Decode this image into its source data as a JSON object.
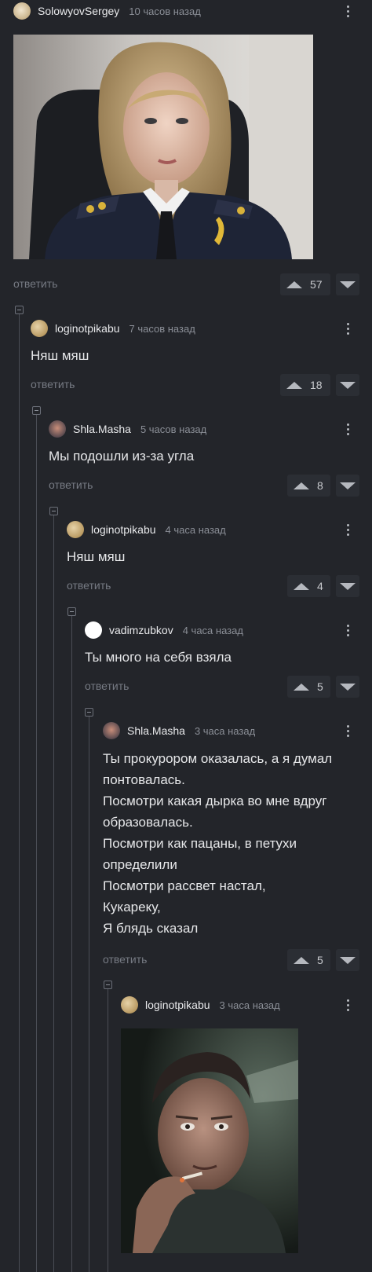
{
  "comments": [
    {
      "user": "SolowyovSergey",
      "time": "10 часов назад",
      "text": "",
      "votes": "57",
      "reply": "ответить",
      "image": "woman-in-uniform-photo"
    },
    {
      "user": "loginotpikabu",
      "time": "7 часов назад",
      "text": "Няш мяш",
      "votes": "18",
      "reply": "ответить"
    },
    {
      "user": "Shla.Masha",
      "time": "5 часов назад",
      "text": "Мы подошли из-за угла",
      "votes": "8",
      "reply": "ответить"
    },
    {
      "user": "loginotpikabu",
      "time": "4 часа назад",
      "text": "Няш мяш",
      "votes": "4",
      "reply": "ответить"
    },
    {
      "user": "vadimzubkov",
      "time": "4 часа назад",
      "text": "Ты много на себя взяла",
      "votes": "5",
      "reply": "ответить"
    },
    {
      "user": "Shla.Masha",
      "time": "3 часа назад",
      "text": "Ты прокурором оказалась, а я думал\nпонтовалась.\nПосмотри какая дырка во мне вдруг\nобразовалась.\nПосмотри как пацаны, в петухи\nопределили\nПосмотри рассвет настал,\nКукареку,\nЯ блядь сказал",
      "votes": "5",
      "reply": "ответить"
    },
    {
      "user": "loginotpikabu",
      "time": "3 часа назад",
      "text": "",
      "image": "man-smoking-photo"
    }
  ],
  "icons": {
    "upvote": "triangle-up-icon",
    "downvote": "triangle-down-icon",
    "menu": "kebab-menu-icon",
    "collapse": "collapse-minus-icon"
  },
  "colors": {
    "background": "#23252a",
    "text": "#e6e7e9",
    "muted": "#8b8f97",
    "line": "#4a4d55"
  }
}
